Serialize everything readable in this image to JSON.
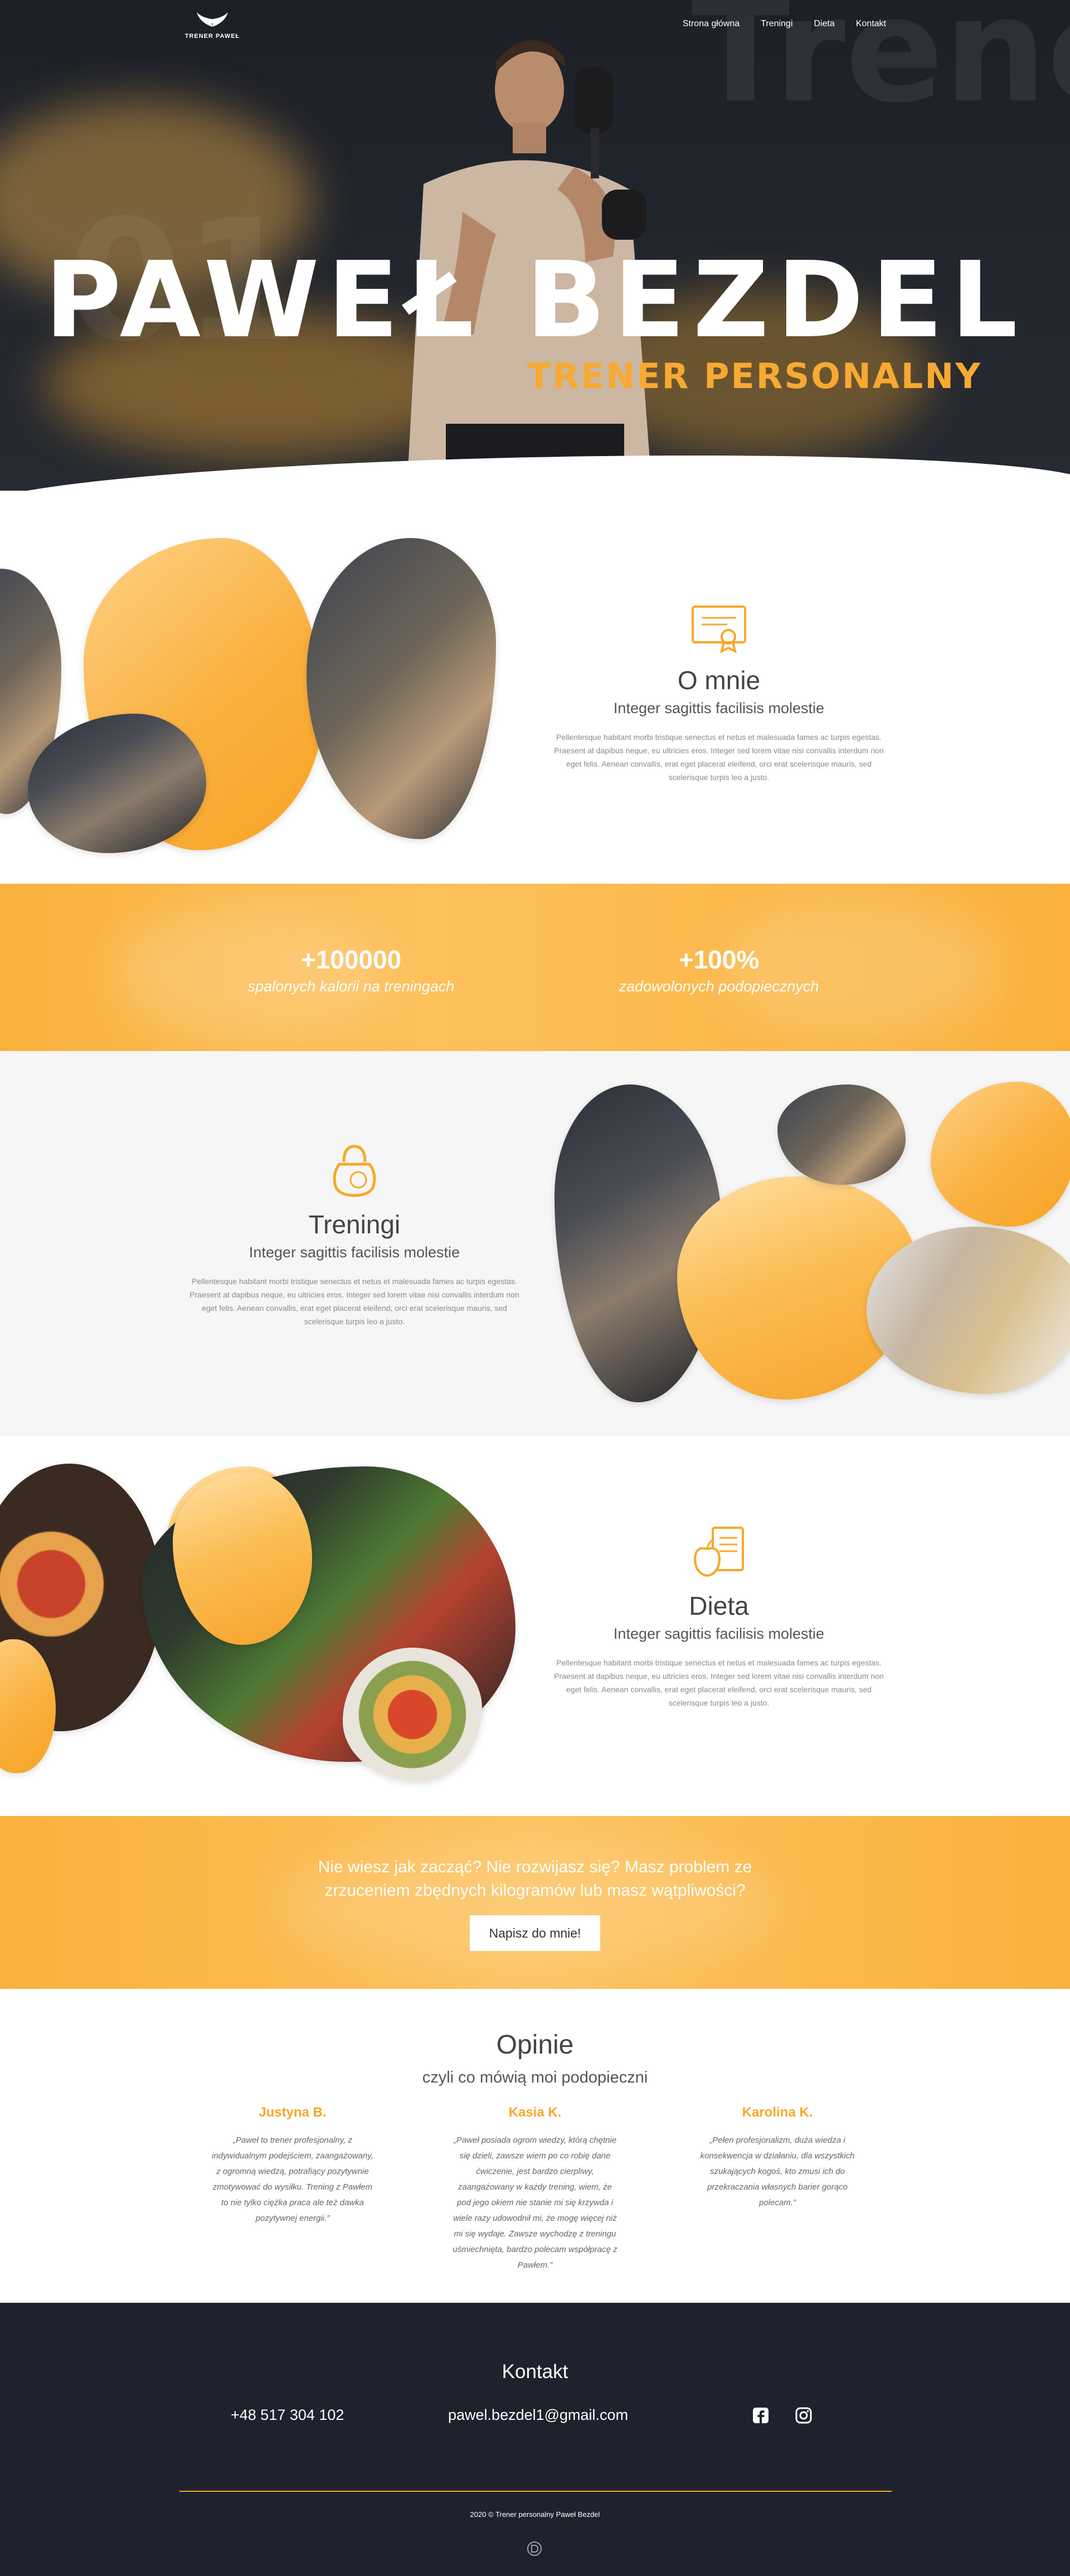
{
  "brand": {
    "logo_text": "TRENER PAWEŁ",
    "accent": "#f7a829",
    "dark": "#1f222c"
  },
  "nav": {
    "items": [
      "Strona główna",
      "Treningi",
      "Dieta",
      "Kontakt"
    ]
  },
  "hero": {
    "name": "PAWEŁ BEZDEL",
    "subtitle": "TRENER PERSONALNY"
  },
  "about": {
    "icon": "certificate-icon",
    "title": "O mnie",
    "subtitle": "Integer sagittis facilisis molestie",
    "text": "Pellentesque habitant morbi tristique senectus et netus et malesuada fames ac turpis egestas. Praesent at dapibus neque, eu ultricies eros. Integer sed lorem vitae nisi convallis interdum non eget felis. Aenean convallis, erat eget placerat eleifend, orci erat scelerisque mauris, sed scelerisque turpis leo a justo."
  },
  "stats": [
    {
      "value": "+100000",
      "label": "spalonych kalorii na treningach"
    },
    {
      "value": "+100%",
      "label": "zadowolonych podopiecznych"
    }
  ],
  "trainings": {
    "icon": "kettlebell-icon",
    "title": "Treningi",
    "subtitle": "Integer sagittis facilisis molestie",
    "text": "Pellentesque habitant morbi tristique senectus et netus et malesuada fames ac turpis egestas. Praesent at dapibus neque, eu ultricies eros. Integer sed lorem vitae nisi convallis interdum non eget felis. Aenean convallis, erat eget placerat eleifend, orci erat scelerisque mauris, sed scelerisque turpis leo a justo."
  },
  "diet": {
    "icon": "diet-plan-icon",
    "title": "Dieta",
    "subtitle": "Integer sagittis facilisis molestie",
    "text": "Pellentesque habitant morbi tristique senectus et netus et malesuada fames ac turpis egestas. Praesent at dapibus neque, eu ultricies eros. Integer sed lorem vitae nisi convallis interdum non eget felis. Aenean convallis, erat eget placerat eleifend, orci erat scelerisque mauris, sed scelerisque turpis leo a justo."
  },
  "cta": {
    "line1": "Nie wiesz jak zacząć? Nie rozwijasz się? Masz problem ze",
    "line2": "zrzuceniem zbędnych kilogramów lub masz wątpliwości?",
    "button": "Napisz do mnie!"
  },
  "opinions": {
    "title": "Opinie",
    "subtitle": "czyli co mówią moi podopieczni",
    "items": [
      {
        "name": "Justyna B.",
        "text": "„Paweł to trener profesjonalny, z indywidualnym podejściem, zaangażowany, z ogromną wiedzą, potrafiący pozytywnie zmotywować do wysiłku. Trening z Pawłem to nie tylko ciężka praca ale też dawka pozytywnej energii.”"
      },
      {
        "name": "Kasia K.",
        "text": "„Paweł posiada ogrom wiedzy, którą chętnie się dzieli, zawsze wiem po co robię dane ćwiczenie, jest bardzo cierpliwy, zaangażowany w każdy trening, wiem, że pod jego okiem nie stanie mi się krzywda i wiele razy udowodnił mi, że mogę więcej niż mi się wydaje. Zawsze wychodzę z treningu uśmiechnięta, bardzo polecam współpracę z Pawłem.”"
      },
      {
        "name": "Karolina K.",
        "text": "„Pełen profesjonalizm, duża wiedza i konsekwencja w działaniu, dla wszystkich szukających kogoś, kto zmusi ich do przekraczania własnych barier gorąco polecam.”"
      }
    ]
  },
  "footer": {
    "title": "Kontakt",
    "phone": "+48 517 304 102",
    "email": "pawel.bezdel1@gmail.com",
    "social": [
      "facebook-icon",
      "instagram-icon"
    ],
    "copyright": "2020 © Trener personalny Paweł Bezdel"
  }
}
